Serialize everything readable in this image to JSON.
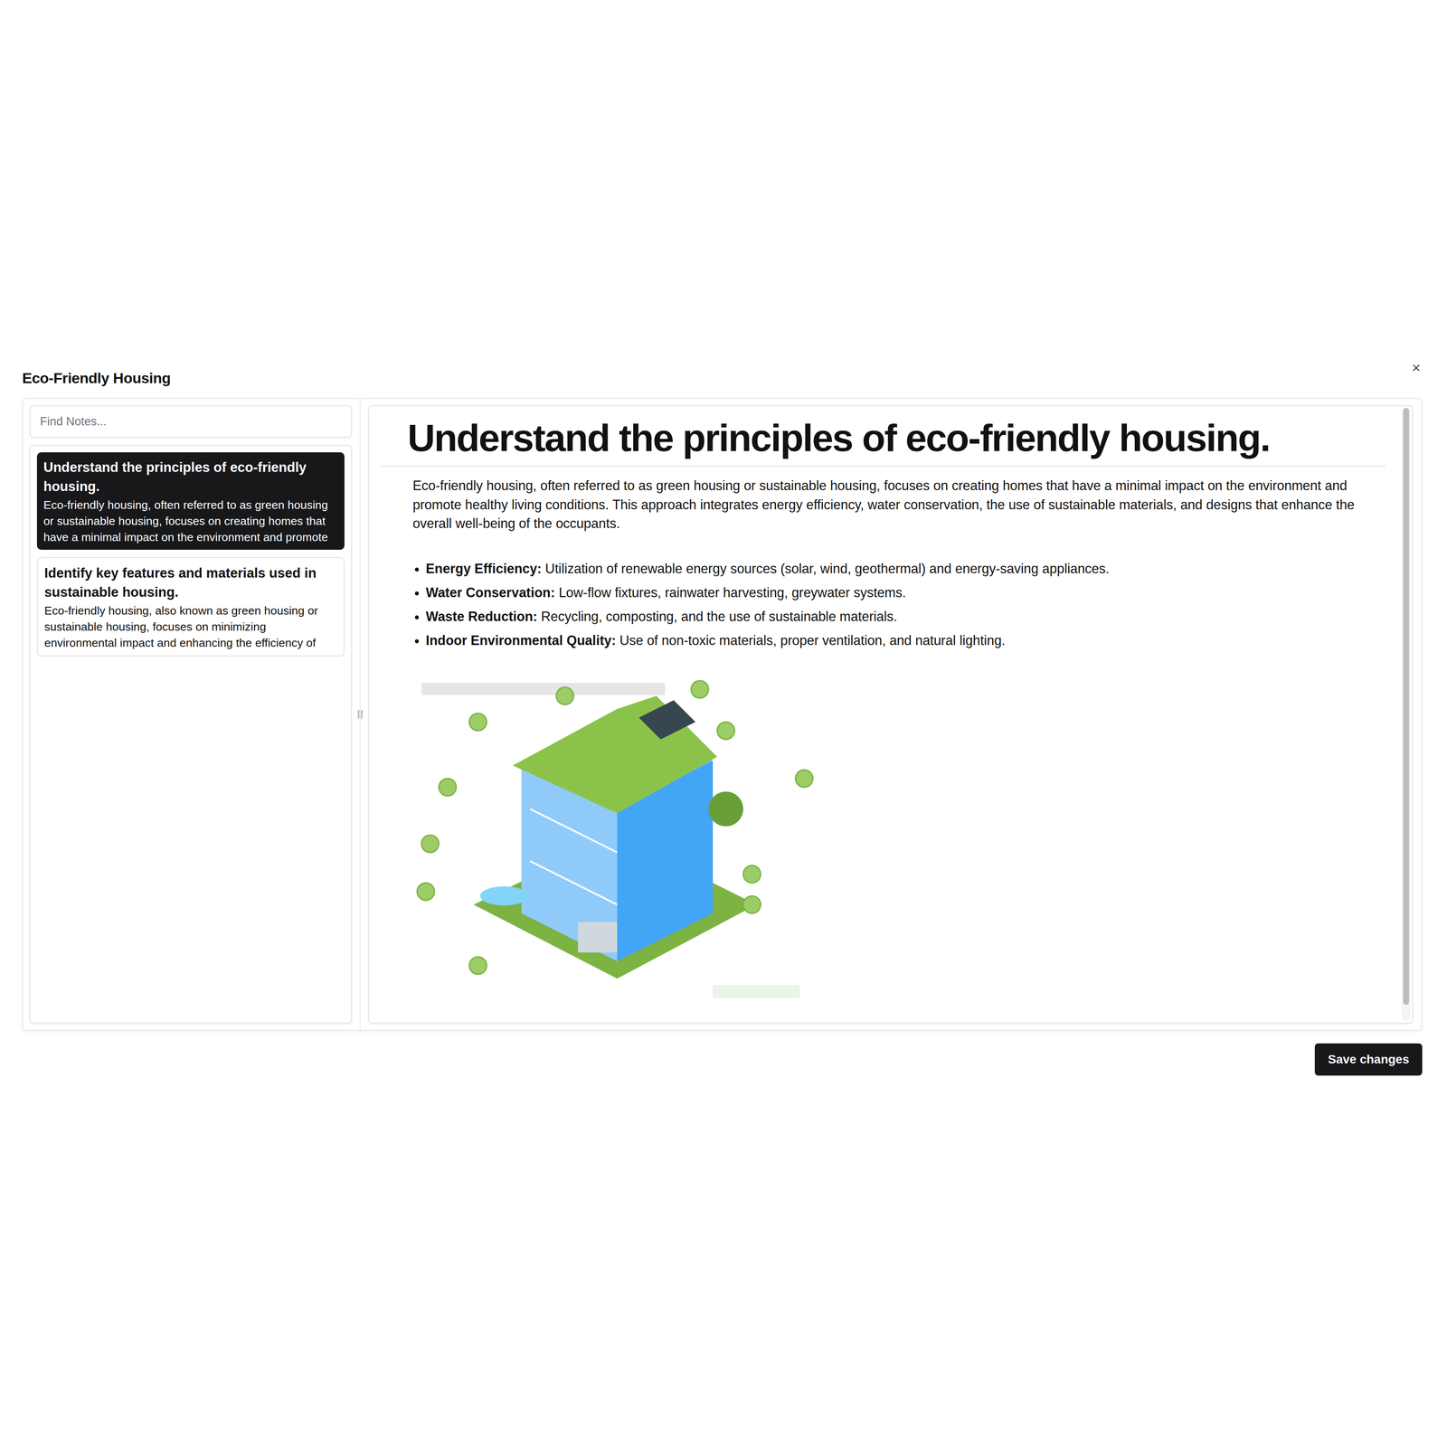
{
  "dialog": {
    "title": "Eco-Friendly Housing",
    "close": "×"
  },
  "search": {
    "placeholder": "Find Notes..."
  },
  "notes": [
    {
      "title": "Understand the principles of eco-friendly housing.",
      "preview": "Eco-friendly housing, often referred to as green housing or sustainable housing, focuses on creating homes that have a minimal impact on the environment and promote",
      "selected": true
    },
    {
      "title": "Identify key features and materials used in sustainable housing.",
      "preview": "Eco-friendly housing, also known as green housing or sustainable housing, focuses on minimizing environmental impact and enhancing the efficiency of",
      "selected": false
    }
  ],
  "editor": {
    "heading": "Understand the principles of eco-friendly housing.",
    "intro": "Eco-friendly housing, often referred to as green housing or sustainable housing, focuses on creating homes that have a minimal impact on the environment and promote healthy living conditions. This approach integrates energy efficiency, water conservation, the use of sustainable materials, and designs that enhance the overall well-being of the occupants.",
    "bullets": [
      {
        "label": "Energy Efficiency:",
        "text": "Utilization of renewable energy sources (solar, wind, geothermal) and energy-saving appliances."
      },
      {
        "label": "Water Conservation:",
        "text": "Low-flow fixtures, rainwater harvesting, greywater systems."
      },
      {
        "label": "Waste Reduction:",
        "text": "Recycling, composting, and the use of sustainable materials."
      },
      {
        "label": "Indoor Environmental Quality:",
        "text": "Use of non-toxic materials, proper ventilation, and natural lighting."
      }
    ]
  },
  "buttons": [
    "Save changes"
  ]
}
